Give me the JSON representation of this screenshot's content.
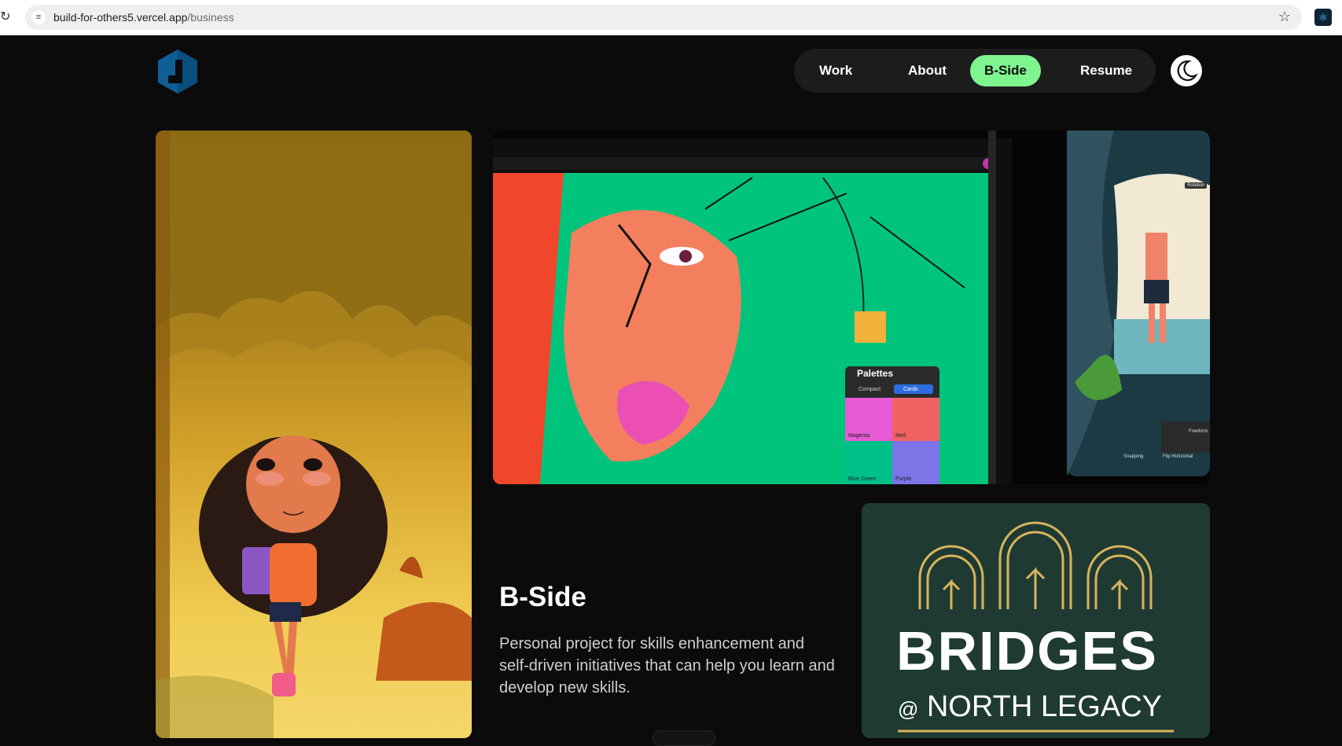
{
  "browser": {
    "url_host": "build-for-others5.vercel.app",
    "url_path": "/business",
    "reload_icon": "reload-icon",
    "star_icon": "bookmark-star-icon"
  },
  "nav": {
    "items": [
      {
        "label": "Work",
        "active": false
      },
      {
        "label": "About",
        "active": false
      },
      {
        "label": "B-Side",
        "active": true
      },
      {
        "label": "Resume",
        "active": false
      }
    ],
    "theme_icon": "moon-icon",
    "accent_color": "#7ef58f"
  },
  "section": {
    "title": "B-Side",
    "description": "Personal project for skills enhancement and self-driven initiatives that can help you learn and develop new skills."
  },
  "ipad_ui": {
    "palettes_title": "Palettes",
    "tab_compact": "Compact",
    "tab_cards": "Cards",
    "swatches": [
      "Magenta",
      "Red",
      "Blue Green",
      "Purple"
    ],
    "rotation_label": "Rotation",
    "freeform_label": "Freeform",
    "snapping_label": "Snapping",
    "flip_label": "Flip Horizontal"
  },
  "bridges": {
    "title": "BRIDGES",
    "subtitle_at": "@",
    "subtitle": "NORTH LEGACY"
  }
}
